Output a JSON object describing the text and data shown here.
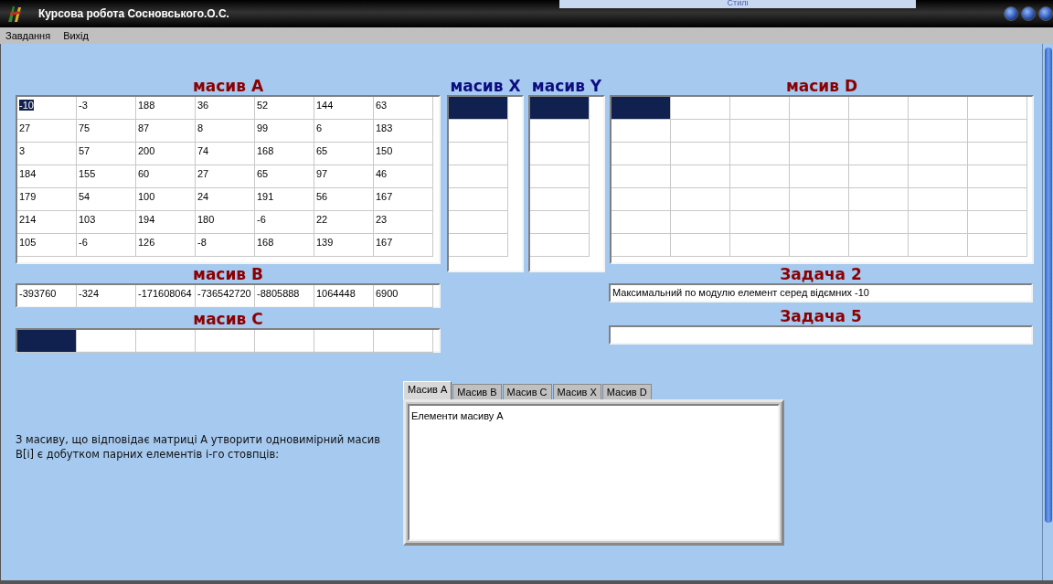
{
  "window": {
    "title": "Курсова робота Сосновського.О.С."
  },
  "background_window": {
    "label": "Стилі"
  },
  "menu": [
    {
      "label": "Завдання"
    },
    {
      "label": "Вихід"
    }
  ],
  "matrix_a": {
    "title": "масив А",
    "rows": [
      [
        {
          "text": "-10",
          "selected": true
        },
        {
          "text": "-3",
          "selected": false
        },
        {
          "text": "188",
          "selected": false
        },
        {
          "text": "36",
          "selected": false
        },
        {
          "text": "52",
          "selected": false
        },
        {
          "text": "144",
          "selected": false
        },
        {
          "text": "63",
          "selected": false
        }
      ],
      [
        {
          "text": "27",
          "selected": false
        },
        {
          "text": "75",
          "selected": false
        },
        {
          "text": "87",
          "selected": false
        },
        {
          "text": "8",
          "selected": false
        },
        {
          "text": "99",
          "selected": false
        },
        {
          "text": "6",
          "selected": false
        },
        {
          "text": "183",
          "selected": false
        }
      ],
      [
        {
          "text": "3",
          "selected": false
        },
        {
          "text": "57",
          "selected": false
        },
        {
          "text": "200",
          "selected": false
        },
        {
          "text": "74",
          "selected": false
        },
        {
          "text": "168",
          "selected": false
        },
        {
          "text": "65",
          "selected": false
        },
        {
          "text": "150",
          "selected": false
        }
      ],
      [
        {
          "text": "184",
          "selected": false
        },
        {
          "text": "155",
          "selected": false
        },
        {
          "text": "60",
          "selected": false
        },
        {
          "text": "27",
          "selected": false
        },
        {
          "text": "65",
          "selected": false
        },
        {
          "text": "97",
          "selected": false
        },
        {
          "text": "46",
          "selected": false
        }
      ],
      [
        {
          "text": "179",
          "selected": false
        },
        {
          "text": "54",
          "selected": false
        },
        {
          "text": "100",
          "selected": false
        },
        {
          "text": "24",
          "selected": false
        },
        {
          "text": "191",
          "selected": false
        },
        {
          "text": "56",
          "selected": false
        },
        {
          "text": "167",
          "selected": false
        }
      ],
      [
        {
          "text": "214",
          "selected": false
        },
        {
          "text": "103",
          "selected": false
        },
        {
          "text": "194",
          "selected": false
        },
        {
          "text": "180",
          "selected": false
        },
        {
          "text": "-6",
          "selected": false
        },
        {
          "text": "22",
          "selected": false
        },
        {
          "text": "23",
          "selected": false
        }
      ],
      [
        {
          "text": "105",
          "selected": false
        },
        {
          "text": "-6",
          "selected": false
        },
        {
          "text": "126",
          "selected": false
        },
        {
          "text": "-8",
          "selected": false
        },
        {
          "text": "168",
          "selected": false
        },
        {
          "text": "139",
          "selected": false
        },
        {
          "text": "167",
          "selected": false
        }
      ]
    ]
  },
  "array_x": {
    "title": "масив X",
    "rows": [
      [
        {
          "selected": true
        }
      ],
      [
        {
          "selected": false
        }
      ],
      [
        {
          "selected": false
        }
      ],
      [
        {
          "selected": false
        }
      ],
      [
        {
          "selected": false
        }
      ],
      [
        {
          "selected": false
        }
      ],
      [
        {
          "selected": false
        }
      ]
    ]
  },
  "array_y": {
    "title": "масив Y",
    "rows": [
      [
        {
          "selected": true
        }
      ],
      [
        {
          "selected": false
        }
      ],
      [
        {
          "selected": false
        }
      ],
      [
        {
          "selected": false
        }
      ],
      [
        {
          "selected": false
        }
      ],
      [
        {
          "selected": false
        }
      ],
      [
        {
          "selected": false
        }
      ]
    ]
  },
  "matrix_d": {
    "title": "масив D",
    "rows": [
      [
        {
          "selected": true
        },
        {
          "selected": false
        },
        {
          "selected": false
        },
        {
          "selected": false
        },
        {
          "selected": false
        },
        {
          "selected": false
        },
        {
          "selected": false
        }
      ],
      [
        {
          "selected": false
        },
        {
          "selected": false
        },
        {
          "selected": false
        },
        {
          "selected": false
        },
        {
          "selected": false
        },
        {
          "selected": false
        },
        {
          "selected": false
        }
      ],
      [
        {
          "selected": false
        },
        {
          "selected": false
        },
        {
          "selected": false
        },
        {
          "selected": false
        },
        {
          "selected": false
        },
        {
          "selected": false
        },
        {
          "selected": false
        }
      ],
      [
        {
          "selected": false
        },
        {
          "selected": false
        },
        {
          "selected": false
        },
        {
          "selected": false
        },
        {
          "selected": false
        },
        {
          "selected": false
        },
        {
          "selected": false
        }
      ],
      [
        {
          "selected": false
        },
        {
          "selected": false
        },
        {
          "selected": false
        },
        {
          "selected": false
        },
        {
          "selected": false
        },
        {
          "selected": false
        },
        {
          "selected": false
        }
      ],
      [
        {
          "selected": false
        },
        {
          "selected": false
        },
        {
          "selected": false
        },
        {
          "selected": false
        },
        {
          "selected": false
        },
        {
          "selected": false
        },
        {
          "selected": false
        }
      ],
      [
        {
          "selected": false
        },
        {
          "selected": false
        },
        {
          "selected": false
        },
        {
          "selected": false
        },
        {
          "selected": false
        },
        {
          "selected": false
        },
        {
          "selected": false
        }
      ]
    ]
  },
  "array_b": {
    "title": "масив В",
    "rows": [
      [
        {
          "text": "-393760",
          "selected": false
        },
        {
          "text": "-324",
          "selected": false
        },
        {
          "text": "-171608064",
          "selected": false
        },
        {
          "text": "-736542720",
          "selected": false
        },
        {
          "text": "-8805888",
          "selected": false
        },
        {
          "text": "1064448",
          "selected": false
        },
        {
          "text": "6900",
          "selected": false
        }
      ]
    ]
  },
  "array_c": {
    "title": "масив С",
    "rows": [
      [
        {
          "selected": true
        },
        {
          "selected": false
        },
        {
          "selected": false
        },
        {
          "selected": false
        },
        {
          "selected": false
        },
        {
          "selected": false
        },
        {
          "selected": false
        }
      ]
    ]
  },
  "task_2": {
    "title": "Задача 2",
    "value": "Максимальний по модулю елемент серед відємних -10"
  },
  "task_5": {
    "title": "Задача 5"
  },
  "description": [
    "З масиву, що відповідає матриці А утворити одновимірний масив",
    "В[і] є добутком парних елементів і-го стовпців:"
  ],
  "tabs": [
    {
      "label": "Масив A",
      "selected": true
    },
    {
      "label": "Масив B",
      "selected": false
    },
    {
      "label": "Масив C",
      "selected": false
    },
    {
      "label": "Масив X",
      "selected": false
    },
    {
      "label": "Масив D",
      "selected": false
    }
  ],
  "memo": {
    "text": "Елементи масиву А"
  }
}
